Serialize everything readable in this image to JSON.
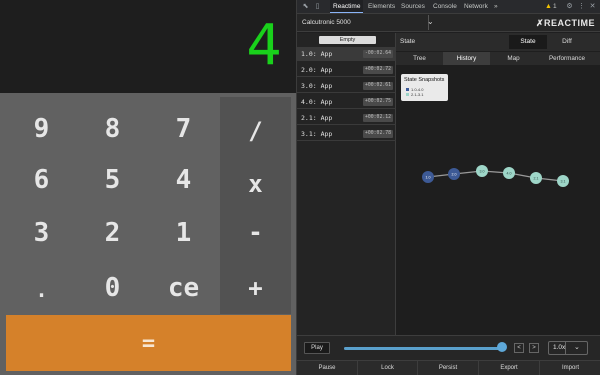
{
  "calculator": {
    "display": "4",
    "keys": {
      "k9": "9",
      "k8": "8",
      "k7": "7",
      "divide": "/",
      "k6": "6",
      "k5": "5",
      "k4": "4",
      "multiply": "x",
      "k3": "3",
      "k2": "2",
      "k1": "1",
      "minus": "-",
      "dot": ".",
      "k0": "0",
      "ce": "ce",
      "plus": "+",
      "equals": "="
    }
  },
  "devtools": {
    "tabs": [
      "Reactime",
      "Elements",
      "Sources",
      "Console",
      "Network"
    ],
    "active_tab": "Reactime",
    "more": "»",
    "warning_count": "1"
  },
  "reactime": {
    "app_name": "Calcutronic 5000",
    "logo": "REACTIME",
    "empty_label": "Empty",
    "snapshots": [
      {
        "label": "1.0: App",
        "time": "-00:02.64"
      },
      {
        "label": "2.0: App",
        "time": "+00:02.72"
      },
      {
        "label": "3.0: App",
        "time": "+00:02.61"
      },
      {
        "label": "4.0: App",
        "time": "+00:02.75"
      },
      {
        "label": "2.1: App",
        "time": "+00:02.12"
      },
      {
        "label": "3.1: App",
        "time": "+00:02.78"
      }
    ],
    "state_title": "State",
    "state_button": "State",
    "diff_button": "Diff",
    "subtabs": [
      "Tree",
      "History",
      "Map",
      "Performance"
    ],
    "active_subtab": "History",
    "snapshots_card": {
      "title": "State Snapshots",
      "legend": [
        {
          "label": "1.0-4.0",
          "color": "#3c5a9a"
        },
        {
          "label": "2.1-3.1",
          "color": "#9ed5c9"
        }
      ]
    },
    "history_nodes": [
      "1.0",
      "2.0",
      "3.0",
      "4.0",
      "2.1",
      "3.1"
    ],
    "history_colors": [
      "#3d5a96",
      "#3d5a96",
      "#9ed6c8",
      "#9ed6c8",
      "#9ed6c8",
      "#9ed6c8"
    ],
    "travel": {
      "play_label": "Play",
      "progress": 1.0,
      "prev": "<",
      "next": ">",
      "speed": "1.0x"
    },
    "actions": [
      "Pause",
      "Lock",
      "Persist",
      "Export",
      "Import"
    ]
  }
}
